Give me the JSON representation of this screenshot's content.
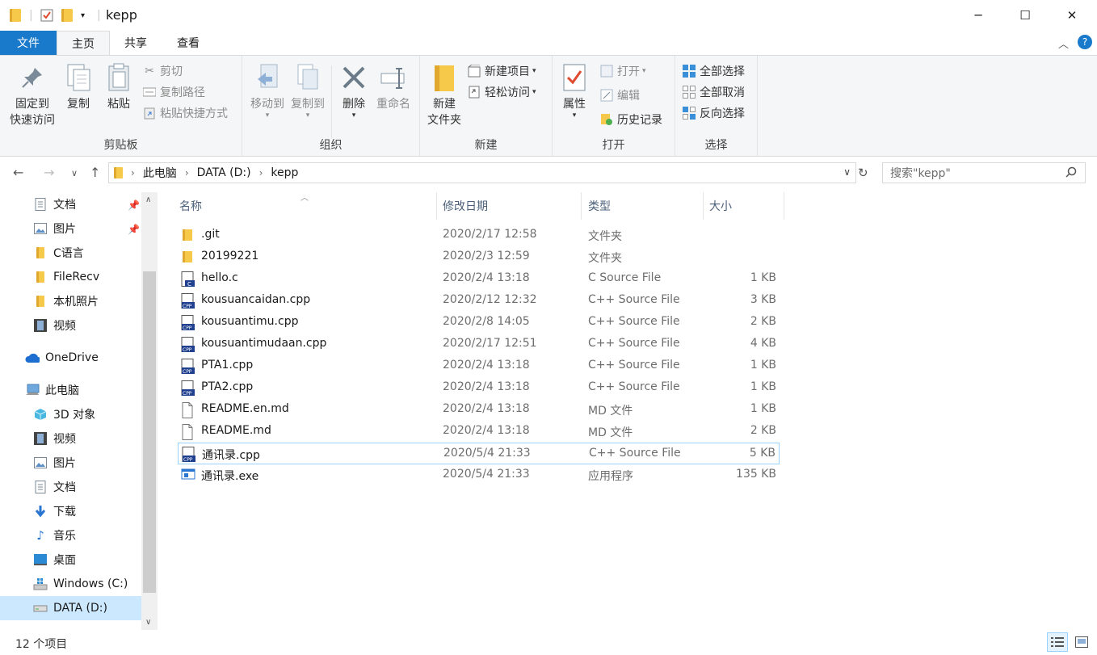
{
  "window": {
    "title": "kepp",
    "minimize": "─",
    "maximize": "☐",
    "close": "✕"
  },
  "tabs": {
    "file": "文件",
    "home": "主页",
    "share": "共享",
    "view": "查看"
  },
  "ribbon": {
    "clipboard": {
      "label": "剪贴板",
      "pin_line1": "固定到",
      "pin_line2": "快速访问",
      "copy": "复制",
      "paste": "粘贴",
      "cut": "剪切",
      "copy_path": "复制路径",
      "paste_shortcut": "粘贴快捷方式"
    },
    "organize": {
      "label": "组织",
      "move_to": "移动到",
      "copy_to": "复制到",
      "delete": "删除",
      "rename": "重命名"
    },
    "new": {
      "label": "新建",
      "new_folder_line1": "新建",
      "new_folder_line2": "文件夹",
      "new_item": "新建项目",
      "easy_access": "轻松访问"
    },
    "open": {
      "label": "打开",
      "properties": "属性",
      "open": "打开",
      "edit": "编辑",
      "history": "历史记录"
    },
    "select": {
      "label": "选择",
      "select_all": "全部选择",
      "select_none": "全部取消",
      "invert": "反向选择"
    }
  },
  "address": {
    "crumbs": [
      "此电脑",
      "DATA (D:)",
      "kepp"
    ],
    "search_placeholder": "搜索\"kepp\""
  },
  "sidebar": {
    "items": [
      {
        "label": "文档",
        "icon": "document-icon",
        "pinned": true
      },
      {
        "label": "图片",
        "icon": "picture-icon",
        "pinned": true
      },
      {
        "label": "C语言",
        "icon": "folder-icon"
      },
      {
        "label": "FileRecv",
        "icon": "folder-icon"
      },
      {
        "label": "本机照片",
        "icon": "folder-icon"
      },
      {
        "label": "视频",
        "icon": "video-icon"
      },
      {
        "label": "OneDrive",
        "icon": "cloud-icon"
      },
      {
        "label": "此电脑",
        "icon": "computer-icon"
      },
      {
        "label": "3D 对象",
        "icon": "cube-icon"
      },
      {
        "label": "视频",
        "icon": "video-icon"
      },
      {
        "label": "图片",
        "icon": "picture-icon"
      },
      {
        "label": "文档",
        "icon": "document-icon"
      },
      {
        "label": "下载",
        "icon": "download-icon"
      },
      {
        "label": "音乐",
        "icon": "music-icon"
      },
      {
        "label": "桌面",
        "icon": "desktop-icon"
      },
      {
        "label": "Windows (C:)",
        "icon": "drive-c-icon"
      },
      {
        "label": "DATA (D:)",
        "icon": "drive-icon",
        "selected": true
      }
    ]
  },
  "columns": {
    "name": "名称",
    "date": "修改日期",
    "type": "类型",
    "size": "大小"
  },
  "files": [
    {
      "name": ".git",
      "date": "2020/2/17 12:58",
      "type": "文件夹",
      "size": "",
      "icon": "folder-icon"
    },
    {
      "name": "20199221",
      "date": "2020/2/3 12:59",
      "type": "文件夹",
      "size": "",
      "icon": "folder-icon"
    },
    {
      "name": "hello.c",
      "date": "2020/2/4 13:18",
      "type": "C Source File",
      "size": "1 KB",
      "icon": "c-file-icon"
    },
    {
      "name": "kousuancaidan.cpp",
      "date": "2020/2/12 12:32",
      "type": "C++ Source File",
      "size": "3 KB",
      "icon": "cpp-file-icon"
    },
    {
      "name": "kousuantimu.cpp",
      "date": "2020/2/8 14:05",
      "type": "C++ Source File",
      "size": "2 KB",
      "icon": "cpp-file-icon"
    },
    {
      "name": "kousuantimudaan.cpp",
      "date": "2020/2/17 12:51",
      "type": "C++ Source File",
      "size": "4 KB",
      "icon": "cpp-file-icon"
    },
    {
      "name": "PTA1.cpp",
      "date": "2020/2/4 13:18",
      "type": "C++ Source File",
      "size": "1 KB",
      "icon": "cpp-file-icon"
    },
    {
      "name": "PTA2.cpp",
      "date": "2020/2/4 13:18",
      "type": "C++ Source File",
      "size": "1 KB",
      "icon": "cpp-file-icon"
    },
    {
      "name": "README.en.md",
      "date": "2020/2/4 13:18",
      "type": "MD 文件",
      "size": "1 KB",
      "icon": "md-file-icon"
    },
    {
      "name": "README.md",
      "date": "2020/2/4 13:18",
      "type": "MD 文件",
      "size": "2 KB",
      "icon": "md-file-icon"
    },
    {
      "name": "通讯录.cpp",
      "date": "2020/5/4 21:33",
      "type": "C++ Source File",
      "size": "5 KB",
      "icon": "cpp-file-icon",
      "focused": true
    },
    {
      "name": "通讯录.exe",
      "date": "2020/5/4 21:33",
      "type": "应用程序",
      "size": "135 KB",
      "icon": "exe-file-icon"
    }
  ],
  "status": {
    "item_count": "12 个项目"
  },
  "colors": {
    "accent": "#1979ca",
    "folder": "#f6c94b",
    "selected": "#cce8ff"
  }
}
